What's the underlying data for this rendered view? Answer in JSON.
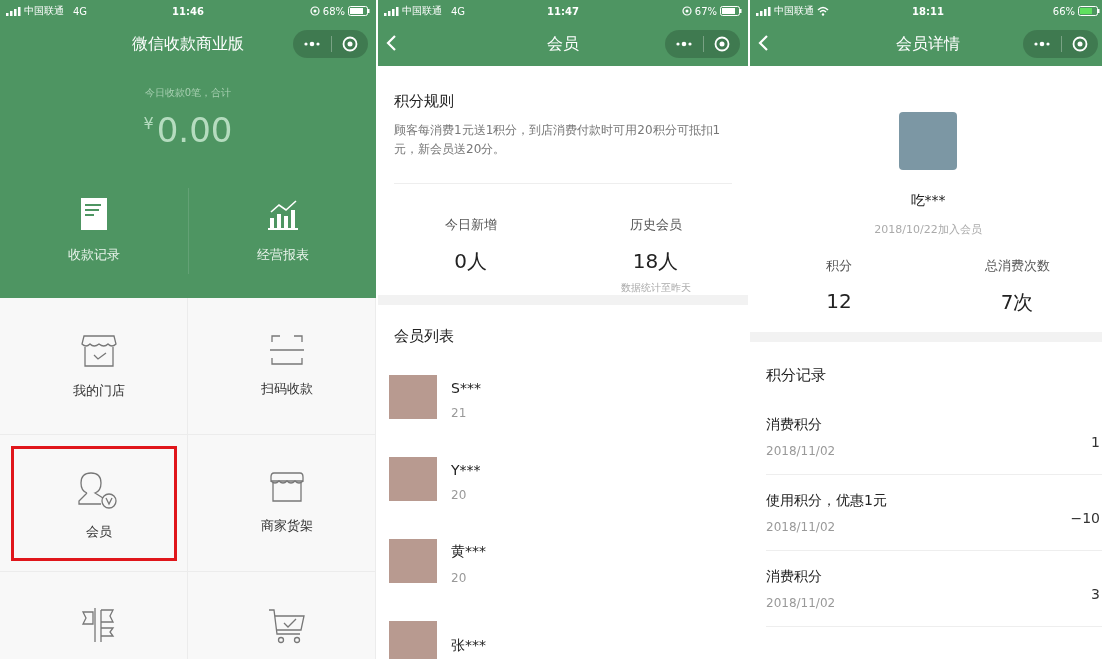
{
  "screens": [
    {
      "status_bar": {
        "carrier": "中国联通",
        "network": "4G",
        "wifi": false,
        "time": "11:46",
        "battery": "68%",
        "location": true
      },
      "nav": {
        "title": "微信收款商业版",
        "back": false
      },
      "summary": {
        "caption": "今日收款0笔，合计",
        "currency": "¥",
        "amount": "0.00"
      },
      "actions": [
        {
          "label": "收款记录"
        },
        {
          "label": "经营报表"
        }
      ],
      "tiles": [
        {
          "label": "我的门店",
          "highlighted": false
        },
        {
          "label": "扫码收款",
          "highlighted": false
        },
        {
          "label": "会员",
          "highlighted": true
        },
        {
          "label": "商家货架",
          "highlighted": false
        },
        {
          "highlighted": false
        },
        {
          "highlighted": false
        }
      ]
    },
    {
      "status_bar": {
        "carrier": "中国联通",
        "network": "4G",
        "wifi": false,
        "time": "11:47",
        "battery": "67%",
        "location": true
      },
      "nav": {
        "title": "会员",
        "back": true
      },
      "rules": {
        "title": "积分规则",
        "text": "顾客每消费1元送1积分，到店消费付款时可用20积分可抵扣1元，新会员送20分。"
      },
      "stats": [
        {
          "label": "今日新增",
          "value": "0人"
        },
        {
          "label": "历史会员",
          "value": "18人",
          "note": "数据统计至昨天"
        }
      ],
      "list": {
        "title": "会员列表",
        "members": [
          {
            "name": "S***",
            "points": "21"
          },
          {
            "name": "Y***",
            "points": "20"
          },
          {
            "name": "黄***",
            "points": "20"
          },
          {
            "name": "张***"
          }
        ]
      }
    },
    {
      "status_bar": {
        "carrier": "中国联通",
        "wifi": true,
        "time": "18:11",
        "battery": "66%",
        "location": false
      },
      "nav": {
        "title": "会员详情",
        "back": true
      },
      "profile": {
        "name": "吃***",
        "joined": "2018/10/22加入会员"
      },
      "stats": [
        {
          "label": "积分",
          "value": "12"
        },
        {
          "label": "总消费次数",
          "value": "7次"
        }
      ],
      "records": {
        "title": "积分记录",
        "items": [
          {
            "title": "消费积分",
            "date": "2018/11/02",
            "points": "1"
          },
          {
            "title": "使用积分，优惠1元",
            "date": "2018/11/02",
            "points": "−10"
          },
          {
            "title": "消费积分",
            "date": "2018/11/02",
            "points": "3"
          }
        ]
      }
    }
  ]
}
